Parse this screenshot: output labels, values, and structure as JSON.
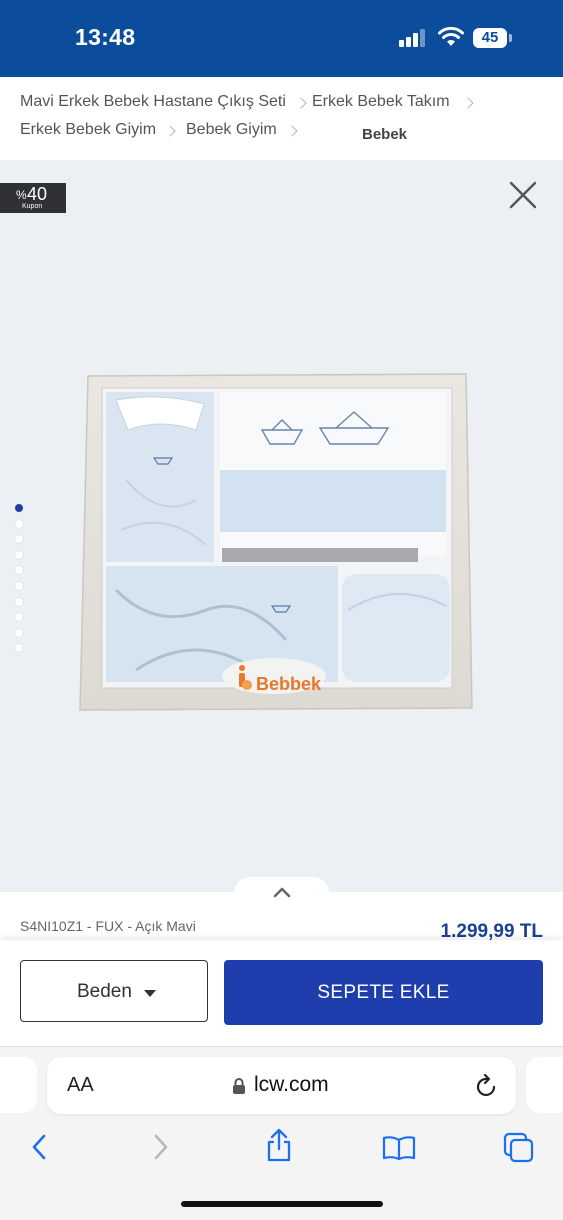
{
  "status_bar": {
    "time": "13:48",
    "battery": "45",
    "background": "#0b4c9c"
  },
  "breadcrumb": {
    "items": [
      "Mavi Erkek Bebek Hastane Çıkış Seti",
      "Erkek Bebek Takım",
      "Erkek Bebek Giyim",
      "Bebek Giyim",
      "Bebek"
    ]
  },
  "gallery": {
    "coupon": {
      "percent_sign": "%",
      "value": "40",
      "label": "Kupon"
    },
    "brand_on_box": "Bebbek",
    "image_count": 10,
    "active_image": 1,
    "close_icon": "close-icon",
    "expand_icon": "chevron-up-icon"
  },
  "product": {
    "sku": "S4NI10Z1 - FUX - Açık Mavi",
    "price": "1.299,99 TL",
    "size_label": "Beden",
    "add_to_cart": "SEPETE EKLE",
    "accent": "#1f3eae"
  },
  "browser": {
    "aa_label": "AA",
    "url": "lcw.com",
    "icons": [
      "back-icon",
      "forward-icon",
      "share-icon",
      "bookmarks-icon",
      "tabs-icon"
    ]
  }
}
